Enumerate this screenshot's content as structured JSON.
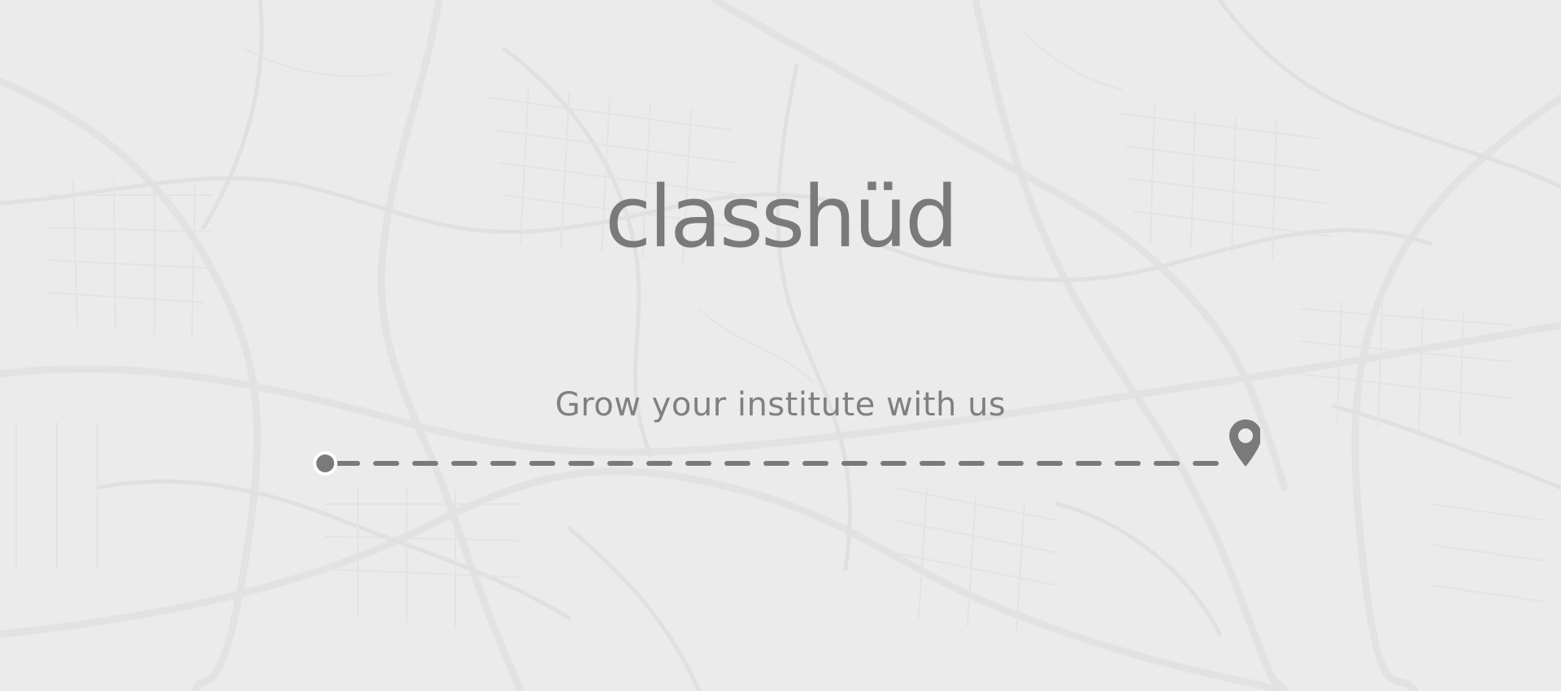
{
  "brand": {
    "logo_text": "classhüd"
  },
  "hero": {
    "tagline": "Grow your institute with us"
  },
  "icons": {
    "start": "start-dot-icon",
    "end": "map-pin-icon"
  },
  "colors": {
    "background": "#ebebeb",
    "map_lines": "#dedede",
    "accent": "#7a7a7a"
  }
}
